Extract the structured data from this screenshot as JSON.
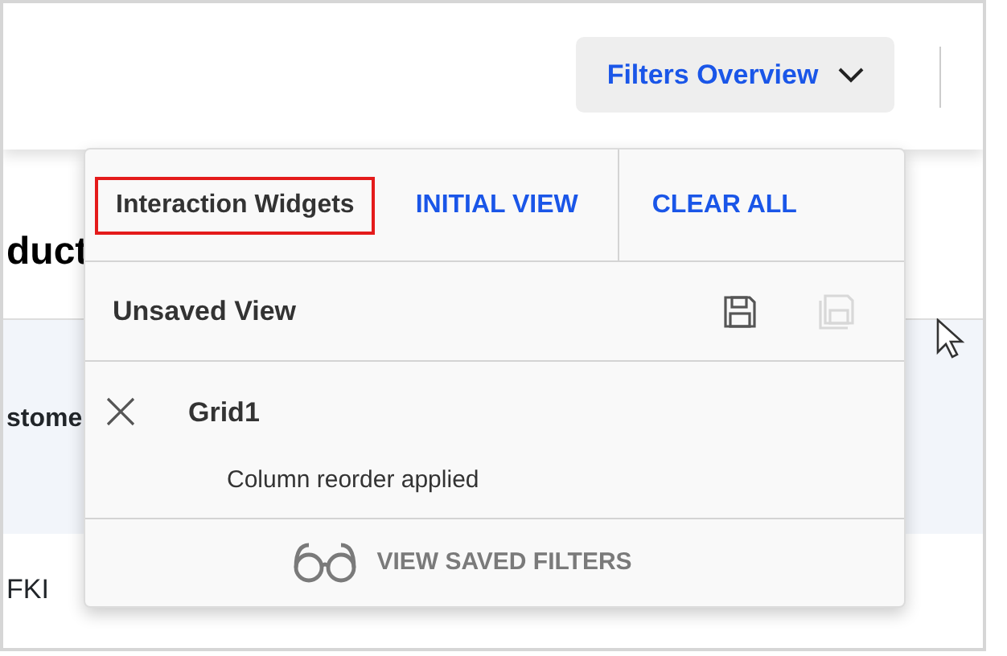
{
  "header": {
    "filters_button": "Filters Overview"
  },
  "background": {
    "title": "duct",
    "column_header": "stome",
    "cell": "FKI"
  },
  "popup": {
    "tabs": [
      {
        "label": "Interaction Widgets",
        "selected": true
      },
      {
        "label": "INITIAL VIEW",
        "selected": false
      },
      {
        "label": "CLEAR ALL",
        "selected": false
      }
    ],
    "view": {
      "name": "Unsaved View",
      "actions": [
        {
          "kind": "save",
          "disabled": false
        },
        {
          "kind": "save-as",
          "disabled": true
        }
      ]
    },
    "applied": [
      {
        "widget": "Grid1",
        "description": "Column reorder applied"
      }
    ],
    "footer_button": "VIEW SAVED FILTERS"
  }
}
